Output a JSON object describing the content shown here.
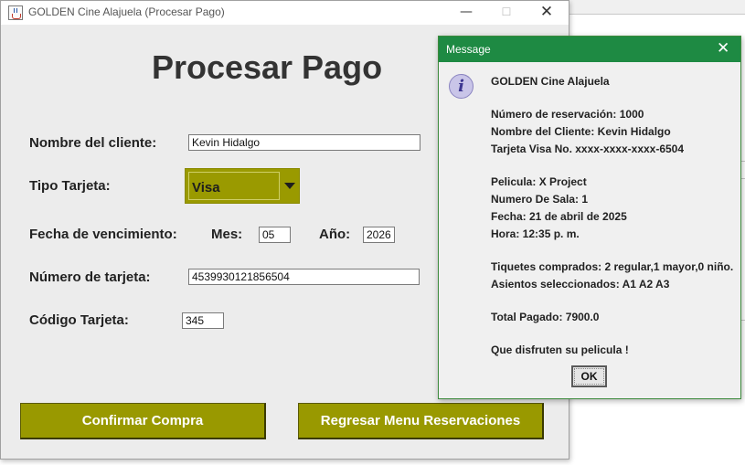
{
  "window": {
    "title": "GOLDEN Cine Alajuela (Procesar Pago)",
    "minimize": "—",
    "maximize": "☐",
    "close": "✕"
  },
  "form": {
    "heading": "Procesar Pago",
    "nombre_label": "Nombre del cliente:",
    "nombre_value": "Kevin Hidalgo",
    "tipo_label": "Tipo Tarjeta:",
    "tipo_value": "Visa",
    "fecha_label": "Fecha de vencimiento:",
    "mes_label": "Mes:",
    "mes_value": "05",
    "anio_label": "Año:",
    "anio_value": "2026",
    "numero_label": "Número de tarjeta:",
    "numero_value": "4539930121856504",
    "codigo_label": "Código Tarjeta:",
    "codigo_value": "345",
    "accent_color": "#999900"
  },
  "buttons": {
    "confirm": "Confirmar Compra",
    "back": "Regresar Menu Reservaciones"
  },
  "dialog": {
    "title": "Message",
    "close": "✕",
    "icon": "information-icon",
    "titlebar_color": "#1e8a43",
    "lines": [
      "GOLDEN Cine Alajuela",
      "Número de reservación: 1000",
      "Nombre del Cliente: Kevin Hidalgo",
      "Tarjeta Visa No. xxxx-xxxx-xxxx-6504",
      "Pelicula: X Project",
      "Numero De Sala: 1",
      "Fecha: 21 de abril  de 2025",
      "Hora: 12:35 p. m.",
      "Tiquetes comprados: 2 regular,1 mayor,0 niño.",
      "Asientos seleccionados: A1 A2 A3",
      "Total Pagado: 7900.0",
      "Que disfruten su pelicula !"
    ],
    "ok": "OK"
  }
}
